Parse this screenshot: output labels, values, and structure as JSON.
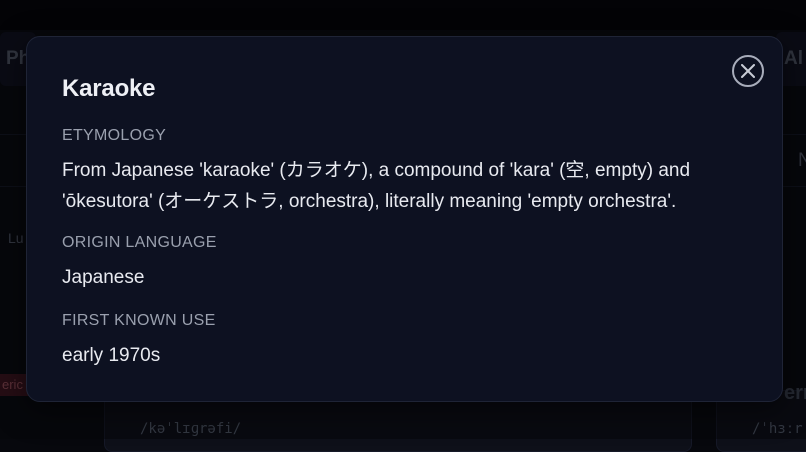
{
  "background": {
    "tab_left_text": "Ph",
    "tab_right_text": "Al",
    "side_text_lu": "Lu",
    "side_text_n": "N",
    "badge_text": "eric",
    "card1_pron": "/kəˈlɪɡrəfi/",
    "card2_pron": "/ˈhɜːr",
    "card2_title": "ern"
  },
  "modal": {
    "title": "Karaoke",
    "close_label": "Close",
    "sections": [
      {
        "label": "ETYMOLOGY",
        "value": "From Japanese 'karaoke' (カラオケ), a compound of 'kara' (空, empty) and 'ōkesutora' (オーケストラ, orchestra), literally meaning 'empty orchestra'."
      },
      {
        "label": "ORIGIN LANGUAGE",
        "value": "Japanese"
      },
      {
        "label": "FIRST KNOWN USE",
        "value": "early 1970s"
      }
    ]
  },
  "colors": {
    "modal_bg": "#0d1121",
    "page_bg": "#07080d",
    "label_color": "#9aa0ae",
    "text_color": "#e8eaf0"
  }
}
